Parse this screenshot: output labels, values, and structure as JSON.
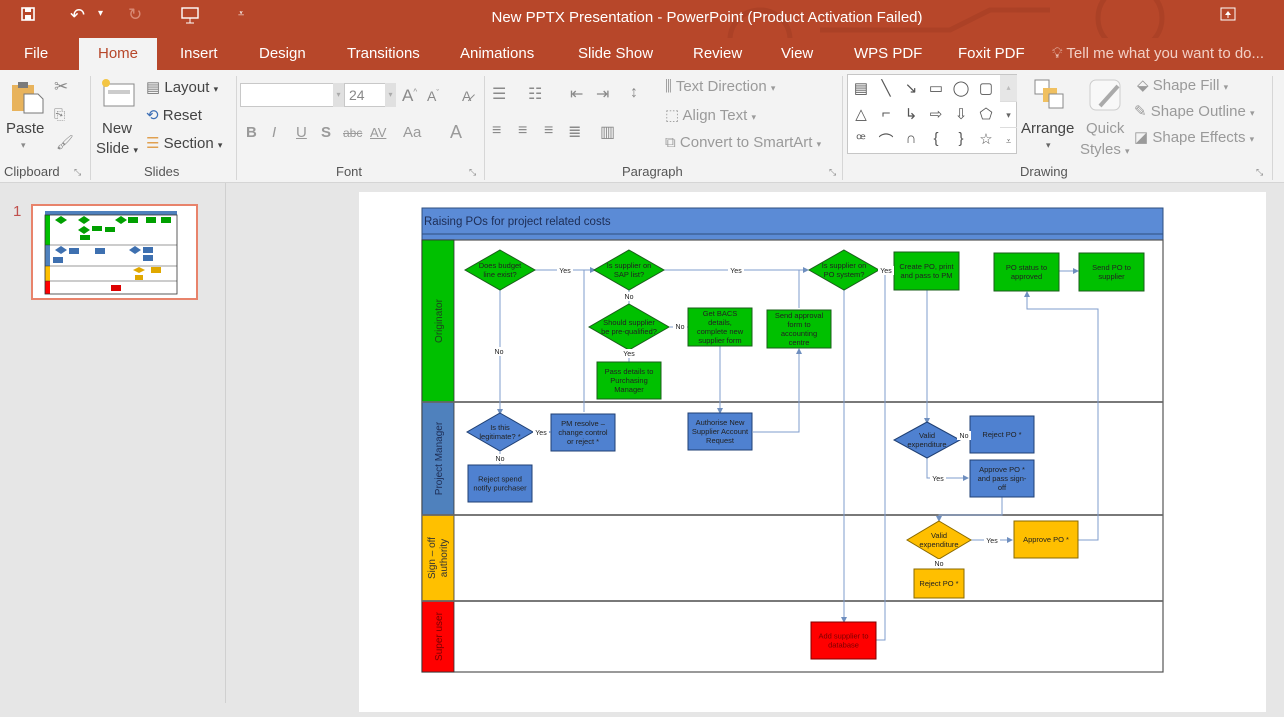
{
  "window": {
    "title": "New PPTX Presentation - PowerPoint (Product Activation Failed)"
  },
  "qat": {
    "save_icon": "save-icon",
    "undo_icon": "undo-icon",
    "redo_icon": "redo-icon",
    "present_icon": "start-from-beginning-icon",
    "customize_icon": "customize-qat-icon",
    "ribbon_display_icon": "ribbon-display-options-icon"
  },
  "tabs": [
    {
      "label": "File"
    },
    {
      "label": "Home",
      "active": true
    },
    {
      "label": "Insert"
    },
    {
      "label": "Design"
    },
    {
      "label": "Transitions"
    },
    {
      "label": "Animations"
    },
    {
      "label": "Slide Show"
    },
    {
      "label": "Review"
    },
    {
      "label": "View"
    },
    {
      "label": "WPS PDF"
    },
    {
      "label": "Foxit PDF"
    }
  ],
  "tellme": "Tell me what you want to do...",
  "ribbon": {
    "clipboard": {
      "label": "Clipboard",
      "paste": "Paste"
    },
    "slides": {
      "label": "Slides",
      "new_slide_1": "New",
      "new_slide_2": "Slide",
      "layout": "Layout",
      "reset": "Reset",
      "section": "Section"
    },
    "font": {
      "label": "Font",
      "font_name": "",
      "font_size": "24",
      "bold": "B",
      "italic": "I",
      "underline": "U",
      "shadow": "S",
      "strike": "abc",
      "spacing": "AV",
      "case": "Aa",
      "color": "A"
    },
    "paragraph": {
      "label": "Paragraph",
      "text_direction": "Text Direction",
      "align_text": "Align Text",
      "smartart": "Convert to SmartArt"
    },
    "drawing": {
      "label": "Drawing",
      "arrange": "Arrange",
      "quick_1": "Quick",
      "quick_2": "Styles",
      "shape_fill": "Shape Fill",
      "shape_outline": "Shape Outline",
      "shape_effects": "Shape Effects"
    }
  },
  "thumbnails": [
    {
      "number": "1"
    }
  ],
  "slide": {
    "title": "Raising POs for project related costs",
    "lanes": [
      {
        "name": "Originator",
        "color": "#00c000"
      },
      {
        "name": "Project Manager",
        "color": "#4f81bd"
      },
      {
        "name": "Sign – off authority",
        "color": "#ffc000"
      },
      {
        "name": "Super user",
        "color": "#ff0000"
      }
    ],
    "shapes": {
      "budget": [
        "Does budget",
        "line exist?"
      ],
      "sap": [
        "Is supplier on",
        "SAP list?"
      ],
      "prequal": [
        "Should supplier",
        "be pre-qualified?"
      ],
      "pass": [
        "Pass details to",
        "Purchasing",
        "Manager"
      ],
      "bacs": [
        "Get BACS",
        "details,",
        "complete new",
        "supplier form"
      ],
      "approval": [
        "Send approval",
        "form to",
        "accounting",
        "centre"
      ],
      "posystem": [
        "Is supplier on",
        "PO system?"
      ],
      "create": [
        "Create PO, print",
        "and pass to PM"
      ],
      "status": [
        "PO status to",
        "approved"
      ],
      "send": [
        "Send PO to",
        "supplier"
      ],
      "legit": [
        "Is this",
        "legitimate? *"
      ],
      "resolve": [
        "PM resolve –",
        "change control",
        "or reject *"
      ],
      "reject_spend": [
        "Reject spend",
        "notify purchaser"
      ],
      "authorise": [
        "Authorise New",
        "Supplier Account",
        "Request"
      ],
      "valid_pm": [
        "Valid",
        "expenditure"
      ],
      "reject_pm": [
        "Reject PO *"
      ],
      "approve_pm": [
        "Approve PO *",
        "and pass sign-",
        "off"
      ],
      "valid_so": [
        "Valid",
        "expenditure"
      ],
      "approve_so": [
        "Approve PO *"
      ],
      "reject_so": [
        "Reject PO *"
      ],
      "add_supplier": [
        "Add supplier to",
        "database"
      ]
    },
    "labels": {
      "yes": "Yes",
      "no": "No"
    }
  }
}
